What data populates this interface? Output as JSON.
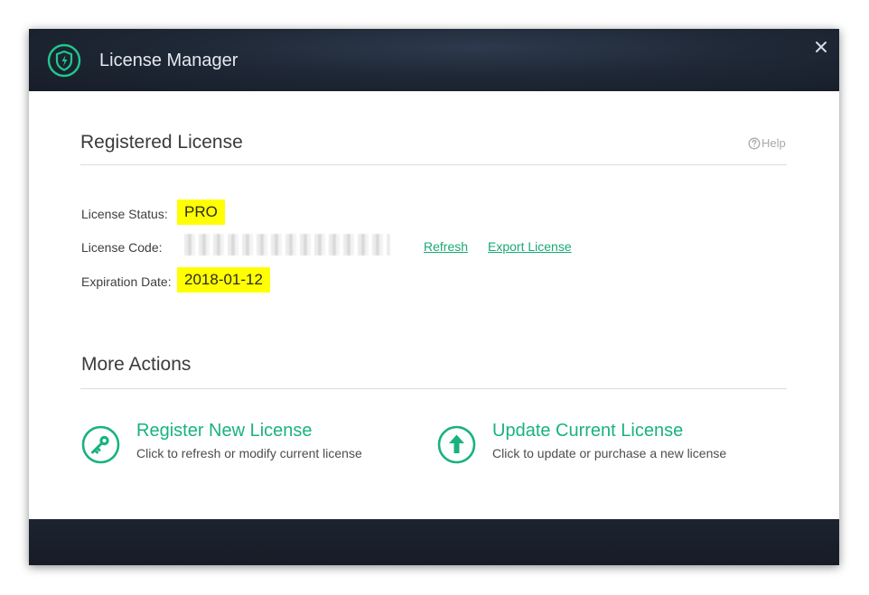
{
  "window": {
    "title": "License Manager",
    "logo_icon": "shield-bolt-icon",
    "close_icon": "close-icon"
  },
  "registered": {
    "title": "Registered License",
    "help_label": "Help",
    "status_label": "License Status:",
    "status_value": "PRO",
    "code_label": "License Code:",
    "refresh_label": "Refresh",
    "export_label": "Export License",
    "expiration_label": "Expiration Date:",
    "expiration_value": "2018-01-12"
  },
  "more_actions": {
    "title": "More Actions",
    "register": {
      "title": "Register New License",
      "desc": "Click to refresh or modify current license",
      "icon": "key-icon"
    },
    "update": {
      "title": "Update Current License",
      "desc": "Click to update or purchase a new license",
      "icon": "arrow-up-icon"
    }
  },
  "colors": {
    "accent": "#19b27f",
    "highlight": "#ffff00",
    "titlebar": "#1f2836"
  }
}
